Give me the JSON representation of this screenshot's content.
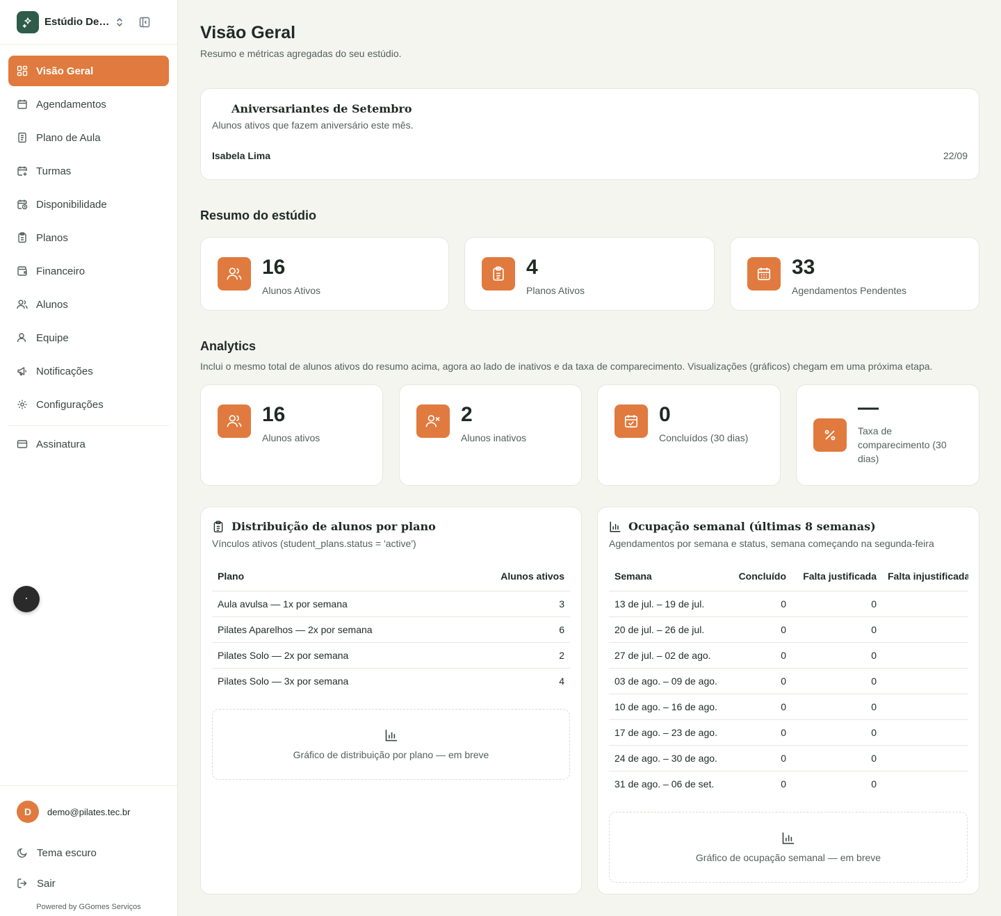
{
  "sidebar": {
    "brand": "Estúdio Demo",
    "items": [
      {
        "label": "Visão Geral",
        "icon": "dashboard-icon",
        "active": true
      },
      {
        "label": "Agendamentos",
        "icon": "calendar-icon"
      },
      {
        "label": "Plano de Aula",
        "icon": "notebook-icon"
      },
      {
        "label": "Turmas",
        "icon": "calendar-plus-icon"
      },
      {
        "label": "Disponibilidade",
        "icon": "calendar-clock-icon"
      },
      {
        "label": "Planos",
        "icon": "clipboard-icon"
      },
      {
        "label": "Financeiro",
        "icon": "wallet-icon"
      },
      {
        "label": "Alunos",
        "icon": "users-icon"
      },
      {
        "label": "Equipe",
        "icon": "user-icon"
      },
      {
        "label": "Notificações",
        "icon": "megaphone-icon"
      },
      {
        "label": "Configurações",
        "icon": "gear-icon"
      }
    ],
    "subscription": "Assinatura",
    "user_initial": "D",
    "user_email": "demo@pilates.tec.br",
    "theme_label": "Tema escuro",
    "logout_label": "Sair",
    "powered_by": "Powered by GGomes Serviços"
  },
  "header": {
    "title": "Visão Geral",
    "subtitle": "Resumo e métricas agregadas do seu estúdio."
  },
  "birthdays": {
    "title": "Aniversariantes de Setembro",
    "subtitle": "Alunos ativos que fazem aniversário este mês.",
    "entries": [
      {
        "name": "Isabela Lima",
        "date": "22/09"
      }
    ]
  },
  "summary": {
    "title": "Resumo do estúdio",
    "cards": [
      {
        "value": "16",
        "label": "Alunos Ativos",
        "icon": "users-icon"
      },
      {
        "value": "4",
        "label": "Planos Ativos",
        "icon": "clipboard-icon"
      },
      {
        "value": "33",
        "label": "Agendamentos Pendentes",
        "icon": "calendar-icon"
      }
    ]
  },
  "analytics": {
    "title": "Analytics",
    "subtitle": "Inclui o mesmo total de alunos ativos do resumo acima, agora ao lado de inativos e da taxa de comparecimento. Visualizações (gráficos) chegam em uma próxima etapa.",
    "cards": [
      {
        "value": "16",
        "label": "Alunos ativos",
        "icon": "users-icon"
      },
      {
        "value": "2",
        "label": "Alunos inativos",
        "icon": "user-x-icon"
      },
      {
        "value": "0",
        "label": "Concluídos (30 dias)",
        "icon": "calendar-check-icon"
      },
      {
        "value": "—",
        "label": "Taxa de comparecimento (30 dias)",
        "icon": "percent-icon"
      }
    ]
  },
  "distribution": {
    "title": "Distribuição de alunos por plano",
    "subtitle": "Vínculos ativos (student_plans.status = 'active')",
    "columns": [
      "Plano",
      "Alunos ativos"
    ],
    "rows": [
      [
        "Aula avulsa — 1x por semana",
        "3"
      ],
      [
        "Pilates Aparelhos — 2x por semana",
        "6"
      ],
      [
        "Pilates Solo — 2x por semana",
        "2"
      ],
      [
        "Pilates Solo — 3x por semana",
        "4"
      ]
    ],
    "placeholder": "Gráfico de distribuição por plano — em breve"
  },
  "occupancy": {
    "title": "Ocupação semanal (últimas 8 semanas)",
    "subtitle": "Agendamentos por semana e status, semana começando na segunda-feira",
    "columns": [
      "Semana",
      "Concluído",
      "Falta justificada",
      "Falta injustificada"
    ],
    "rows": [
      [
        "13 de jul. – 19 de jul.",
        "0",
        "0"
      ],
      [
        "20 de jul. – 26 de jul.",
        "0",
        "0"
      ],
      [
        "27 de jul. – 02 de ago.",
        "0",
        "0"
      ],
      [
        "03 de ago. – 09 de ago.",
        "0",
        "0"
      ],
      [
        "10 de ago. – 16 de ago.",
        "0",
        "0"
      ],
      [
        "17 de ago. – 23 de ago.",
        "0",
        "0"
      ],
      [
        "24 de ago. – 30 de ago.",
        "0",
        "0"
      ],
      [
        "31 de ago. – 06 de set.",
        "0",
        "0"
      ]
    ],
    "placeholder": "Gráfico de ocupação semanal — em breve"
  }
}
